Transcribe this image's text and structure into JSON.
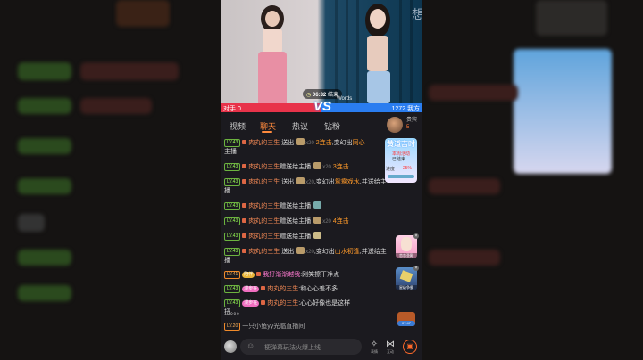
{
  "video": {
    "timer_icon": "clock-icon",
    "timer": "06:32",
    "timer_tail": "结束",
    "vs": "VS",
    "words": "Words",
    "watermark": "想"
  },
  "pk_bar": {
    "left_label": "对手",
    "left_value": "0",
    "right_value": "1272",
    "right_label": "我方"
  },
  "tabs": [
    {
      "label": "视频",
      "active": false
    },
    {
      "label": "聊天",
      "active": true
    },
    {
      "label": "热议",
      "active": false
    },
    {
      "label": "钻粉",
      "active": false
    }
  ],
  "guest_label": "贵宾",
  "guest_count": "5",
  "chat": [
    {
      "level": "LV.43",
      "user": "肉丸的三生",
      "verb": "送出",
      "multi": "x20",
      "accent": "2连击",
      "tail": ",变幻出",
      "tail_accent": "同心",
      "wrap": "主播"
    },
    {
      "level": "LV.43",
      "user": "肉丸的三生",
      "verb": "赠送给主播",
      "multi": "x20",
      "accent": "3连击"
    },
    {
      "level": "LV.43",
      "user": "肉丸的三生",
      "verb": "送出",
      "multi": "x20",
      "tail": ",变幻出",
      "tail_accent": "鸳鸯戏水",
      "tail2": ",并送给主",
      "wrap": "播"
    },
    {
      "level": "LV.43",
      "user": "肉丸的三生",
      "verb": "赠送给主播"
    },
    {
      "level": "LV.43",
      "user": "肉丸的三生",
      "verb": "赠送给主播",
      "multi": "x20",
      "accent": "4连击"
    },
    {
      "level": "LV.43",
      "user": "肉丸的三生",
      "verb": "赠送给主播"
    },
    {
      "level": "LV.43",
      "user": "肉丸的三生",
      "verb": "送出",
      "multi": "x20",
      "tail": ",变幻出",
      "tail_accent": "山水初逢",
      "tail2": ",并送给主",
      "wrap": "播"
    },
    {
      "level": "LV.41",
      "badge": "陪伴",
      "user": "我好渐渐越我",
      "text": ":刚笑擦干净点"
    },
    {
      "level": "LV.43",
      "badge": "漫步在",
      "user": "肉丸的三生",
      "text": ":和心心差不多"
    },
    {
      "level": "LV.43",
      "badge": "漫步在",
      "user": "肉丸的三生",
      "text": ":心心好像也是这样",
      "wrap": "扭。。。"
    },
    {
      "level": "LV.20",
      "user": "一只小鱼yy",
      "verb": "光临直播间",
      "plain_user": true
    }
  ],
  "side_promo": {
    "title": "黄道吉时",
    "line1": "本周活动",
    "line2": "已结束",
    "line3": "进度",
    "percent": "25%"
  },
  "side_cards": [
    {
      "label": "恋恋圣殿"
    },
    {
      "label": "星级争霸"
    }
  ],
  "side_coin": "07:47",
  "bottom": {
    "placeholder": "梗弹幕玩法火爆上线",
    "emoji_icon": "emoji-icon",
    "emote_label": "表情",
    "interact_label": "互动",
    "gift_icon": "gift-icon"
  }
}
